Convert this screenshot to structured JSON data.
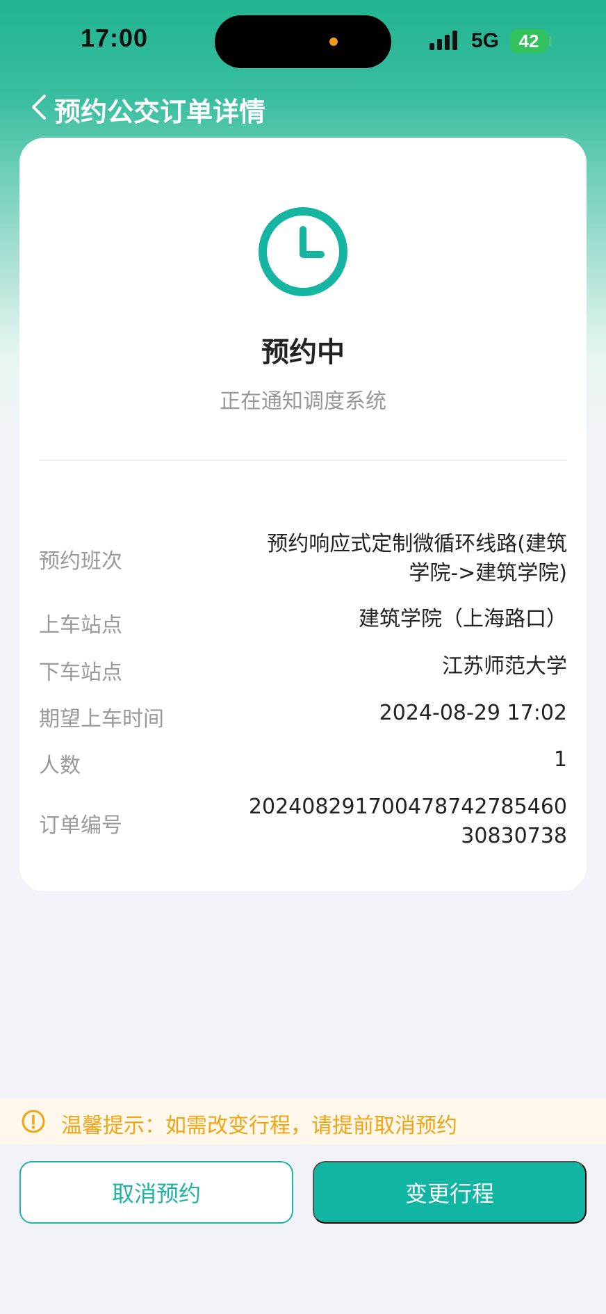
{
  "status_bar": {
    "time": "17:00",
    "network": "5G",
    "battery": "42"
  },
  "nav": {
    "title": "预约公交订单详情"
  },
  "order": {
    "status_title": "预约中",
    "status_subtitle": "正在通知调度系统",
    "fields": [
      {
        "label": "预约班次",
        "value_line1": "预约响应式定制微循环线路(建筑",
        "value_line2": "学院->建筑学院)"
      },
      {
        "label": "上车站点",
        "value": "建筑学院（上海路口）"
      },
      {
        "label": "下车站点",
        "value": "江苏师范大学"
      },
      {
        "label": "期望上车时间",
        "value": "2024-08-29 17:02"
      },
      {
        "label": "人数",
        "value": "1"
      },
      {
        "label": "订单编号",
        "value_line1": "20240829170047874278546​0",
        "value_line2": "30830738"
      }
    ]
  },
  "tip": {
    "text": "温馨提示：如需改变行程，请提前取消预约"
  },
  "actions": {
    "cancel_label": "取消预约",
    "change_label": "变更行程"
  },
  "colors": {
    "brand": "#11b5a1",
    "tip": "#f2a413"
  }
}
